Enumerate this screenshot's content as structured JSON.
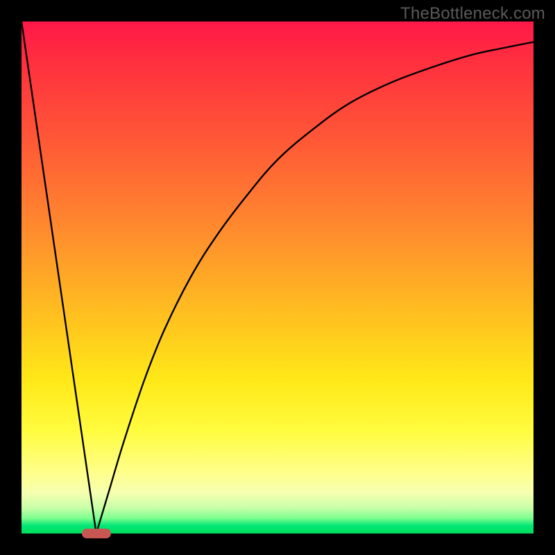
{
  "watermark": "TheBottleneck.com",
  "chart_data": {
    "type": "line",
    "title": "",
    "xlabel": "",
    "ylabel": "",
    "xlim": [
      0,
      100
    ],
    "ylim": [
      0,
      100
    ],
    "grid": false,
    "legend": false,
    "series": [
      {
        "name": "left-branch",
        "x": [
          0,
          14.6
        ],
        "values": [
          100,
          0
        ]
      },
      {
        "name": "right-branch",
        "x": [
          14.6,
          17,
          20,
          24,
          28,
          33,
          38,
          44,
          50,
          57,
          64,
          72,
          80,
          88,
          94,
          100
        ],
        "values": [
          0,
          8,
          18,
          30,
          40,
          50,
          58,
          66,
          73,
          79,
          84,
          88,
          91,
          93.5,
          94.8,
          96
        ]
      }
    ],
    "minimum_marker": {
      "x": 14.6,
      "y": 0
    },
    "marker_color": "#c85754",
    "curve_color": "#000000",
    "gradient_stops": [
      {
        "pos": 0,
        "color": "#ff1848"
      },
      {
        "pos": 0.5,
        "color": "#ffb224"
      },
      {
        "pos": 0.82,
        "color": "#ffff55"
      },
      {
        "pos": 0.97,
        "color": "#7dff8e"
      },
      {
        "pos": 1.0,
        "color": "#00e05c"
      }
    ]
  }
}
